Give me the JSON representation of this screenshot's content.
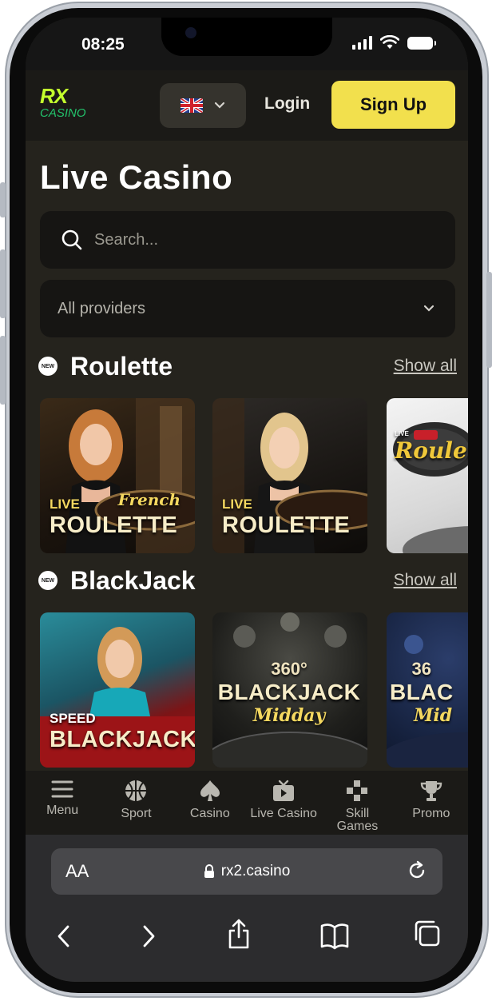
{
  "status_bar": {
    "time": "08:25"
  },
  "header": {
    "logo_text": "RX",
    "logo_sub": "CASINO",
    "login_label": "Login",
    "signup_label": "Sign Up"
  },
  "main": {
    "title": "Live Casino",
    "search_placeholder": "Search...",
    "provider_select": "All providers",
    "sections": [
      {
        "badge": "NEW",
        "title": "Roulette",
        "show_all": "Show all",
        "games": [
          {
            "small": "LIVE",
            "big": "ROULETTE",
            "script": "French"
          },
          {
            "small": "LIVE",
            "big": "ROULETTE"
          },
          {
            "small": "LIVE",
            "script": "Roulette"
          }
        ]
      },
      {
        "badge": "NEW",
        "title": "BlackJack",
        "show_all": "Show all",
        "games": [
          {
            "small": "SPEED",
            "big": "BLACKJACK"
          },
          {
            "small": "360°",
            "big": "BLACKJACK",
            "script": "Midday"
          },
          {
            "small": "36",
            "big": "BLAC",
            "script": "Mid"
          }
        ]
      }
    ]
  },
  "bottom_nav": [
    {
      "label": "Menu",
      "icon": "hamburger-icon"
    },
    {
      "label": "Sport",
      "icon": "basketball-icon"
    },
    {
      "label": "Casino",
      "icon": "spade-icon"
    },
    {
      "label": "Live Casino",
      "icon": "tv-play-icon"
    },
    {
      "label": "Skill Games",
      "icon": "gamepad-cross-icon"
    },
    {
      "label": "Promo",
      "icon": "trophy-icon"
    }
  ],
  "browser": {
    "text_size_label": "AA",
    "url": "rx2.casino"
  },
  "colors": {
    "accent_yellow": "#f2e04d",
    "background": "#25231d",
    "header": "#1b1a17"
  }
}
